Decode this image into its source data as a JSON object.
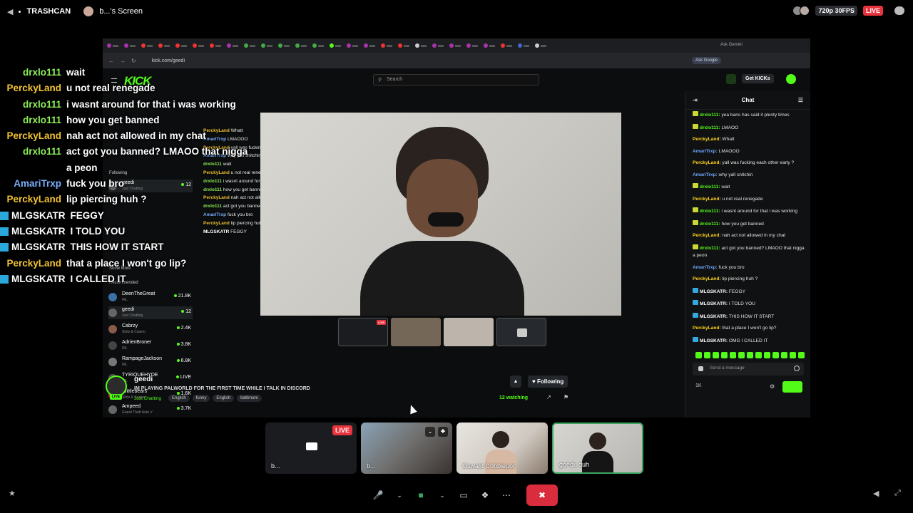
{
  "topbar": {
    "channel": "TRASHCAN",
    "screen_label": "b...'s Screen",
    "quality": "720p 30FPS",
    "live": "LIVE"
  },
  "browser": {
    "url": "kick.com/geedi",
    "ask_gemini": "Ask Gemini",
    "ask_google": "Ask Google"
  },
  "kick": {
    "logo": "KICK",
    "search_placeholder": "Search",
    "get_kicks": "Get KICKs",
    "following_header": "Following",
    "recommended_header": "Recommended",
    "show_more": "Show More",
    "following": [
      {
        "name": "geedi",
        "cat": "Just Chatting",
        "viewers": "12"
      }
    ],
    "recommended": [
      {
        "name": "DeenTheGreat",
        "cat": "IRL",
        "viewers": "21.8K"
      },
      {
        "name": "geedi",
        "cat": "Just Chatting",
        "viewers": "12"
      },
      {
        "name": "Cabrzy",
        "cat": "Slots & Casino",
        "viewers": "2.4K"
      },
      {
        "name": "AdrienBroner",
        "cat": "IRL",
        "viewers": "3.8K"
      },
      {
        "name": "RampageJackson",
        "cat": "IRL",
        "viewers": "6.8K"
      },
      {
        "name": "TYRIQUEHYDE",
        "cat": "IRL",
        "viewers": "LIVE"
      },
      {
        "name": "Wittlebears",
        "cat": "Slots & Casino",
        "viewers": "1.6K"
      },
      {
        "name": "Ampeed",
        "cat": "Grand Theft Auto V",
        "viewers": "3.7K"
      }
    ],
    "stream": {
      "streamer": "geedi",
      "title": "IM PLAYING PALWORLD FOR THE FIRST TIME WHILE I TALK IN DISCORD",
      "category": "Just Chatting",
      "tags": [
        "English",
        "funny",
        "English",
        "baltimore"
      ],
      "following_label": "Following",
      "watching": "12 watching",
      "live": "LIVE"
    },
    "overlay_chat": [
      {
        "u": "PerckyLand",
        "t": "Whatt"
      },
      {
        "u": "AmariTrxp",
        "t": "LMAOOO"
      },
      {
        "u": "PerckyLand",
        "t": "yall was fucking each other early ?"
      },
      {
        "u": "AmariTrxp",
        "t": "why yall snitchin"
      },
      {
        "u": "drxlo111",
        "t": "wait"
      },
      {
        "u": "PerckyLand",
        "t": "u not real renegade"
      },
      {
        "u": "drxlo111",
        "t": "i wasnt around for that i was working"
      },
      {
        "u": "drxlo111",
        "t": "how you get banned"
      },
      {
        "u": "PerckyLand",
        "t": "nah act not allowed in my chat"
      },
      {
        "u": "drxlo111",
        "t": "act got you banned? LMAOO that nigga a peon"
      },
      {
        "u": "AmariTrxp",
        "t": "fuck you bro"
      },
      {
        "u": "PerckyLand",
        "t": "lip piercing huh ?"
      },
      {
        "u": "MLGSKATR",
        "t": "FEGGY"
      }
    ],
    "chat": {
      "header": "Chat",
      "send_placeholder": "Send a message",
      "kicks_count": "1K",
      "messages": [
        {
          "badge": "yellow",
          "u": "drxlo111",
          "c": "#53fc18",
          "t": "yea bans has said it plenty times"
        },
        {
          "badge": "yellow",
          "u": "drxlo111",
          "c": "#53fc18",
          "t": "LMAOO"
        },
        {
          "badge": "",
          "u": "PerckyLand",
          "c": "#ffd21f",
          "t": "Whatt"
        },
        {
          "badge": "",
          "u": "AmariTrxp",
          "c": "#6fa8ff",
          "t": "LMAOOO"
        },
        {
          "badge": "",
          "u": "PerckyLand",
          "c": "#ffd21f",
          "t": "yall was fucking each other early ?"
        },
        {
          "badge": "",
          "u": "AmariTrxp",
          "c": "#6fa8ff",
          "t": "why yall snitchin"
        },
        {
          "badge": "yellow",
          "u": "drxlo111",
          "c": "#53fc18",
          "t": "wait"
        },
        {
          "badge": "",
          "u": "PerckyLand",
          "c": "#ffd21f",
          "t": "u not real renegade"
        },
        {
          "badge": "yellow",
          "u": "drxlo111",
          "c": "#53fc18",
          "t": "i wasnt around for that i was working"
        },
        {
          "badge": "yellow",
          "u": "drxlo111",
          "c": "#53fc18",
          "t": "how you get banned"
        },
        {
          "badge": "",
          "u": "PerckyLand",
          "c": "#ffd21f",
          "t": "nah act not allowed in my chat"
        },
        {
          "badge": "yellow",
          "u": "drxlo111",
          "c": "#53fc18",
          "t": "act got you banned? LMAOO that nigga a peon"
        },
        {
          "badge": "",
          "u": "AmariTrxp",
          "c": "#6fa8ff",
          "t": "fuck you bro"
        },
        {
          "badge": "",
          "u": "PerckyLand",
          "c": "#ffd21f",
          "t": "lip piercing huh ?"
        },
        {
          "badge": "blue",
          "u": "MLGSKATR",
          "c": "#ffffff",
          "t": "FEGGY"
        },
        {
          "badge": "blue",
          "u": "MLGSKATR",
          "c": "#ffffff",
          "t": "I TOLD YOU"
        },
        {
          "badge": "blue",
          "u": "MLGSKATR",
          "c": "#ffffff",
          "t": "THIS HOW IT START"
        },
        {
          "badge": "",
          "u": "PerckyLand",
          "c": "#ffd21f",
          "t": "that a place I won't go lip?"
        },
        {
          "badge": "blue",
          "u": "MLGSKATR",
          "c": "#ffffff",
          "t": "OMG I CALLED IT"
        }
      ]
    }
  },
  "overlay": [
    {
      "u": "drxlo111",
      "c": "#8ff05a",
      "t": "wait"
    },
    {
      "u": "PerckyLand",
      "c": "#f1c232",
      "t": "u not real renegade"
    },
    {
      "u": "drxlo111",
      "c": "#8ff05a",
      "t": "i wasnt around for that i was working"
    },
    {
      "u": "drxlo111",
      "c": "#8ff05a",
      "t": "how you get banned"
    },
    {
      "u": "PerckyLand",
      "c": "#f1c232",
      "t": "nah act not allowed in my chat"
    },
    {
      "u": "drxlo111",
      "c": "#8ff05a",
      "t": "act got you banned? LMAOO that nigga"
    },
    {
      "u": "",
      "c": "#8ff05a",
      "t": "a peon"
    },
    {
      "u": "AmariTrxp",
      "c": "#7ab0ff",
      "t": "fuck you bro"
    },
    {
      "u": "PerckyLand",
      "c": "#f1c232",
      "t": "lip piercing huh ?"
    },
    {
      "u": "MLGSKATR",
      "c": "#ffffff",
      "t": "FEGGY",
      "badge": true
    },
    {
      "u": "MLGSKATR",
      "c": "#ffffff",
      "t": "I TOLD YOU",
      "badge": true
    },
    {
      "u": "MLGSKATR",
      "c": "#ffffff",
      "t": "THIS HOW IT START",
      "badge": true
    },
    {
      "u": "PerckyLand",
      "c": "#f1c232",
      "t": "that a place I won't go lip?"
    },
    {
      "u": "MLGSKATR",
      "c": "#ffffff",
      "t": "I CALLED IT",
      "badge": true
    }
  ],
  "tiles": [
    {
      "name": "b...",
      "live": "LIVE"
    },
    {
      "name": "b..."
    },
    {
      "name": "Oswald Cobblepot"
    },
    {
      "name": "geedi, duh"
    }
  ],
  "colors": {
    "kick_green": "#53fc18",
    "live_red": "#e8323c",
    "end_call": "#d92c3c",
    "speaking": "#3ba55d"
  }
}
